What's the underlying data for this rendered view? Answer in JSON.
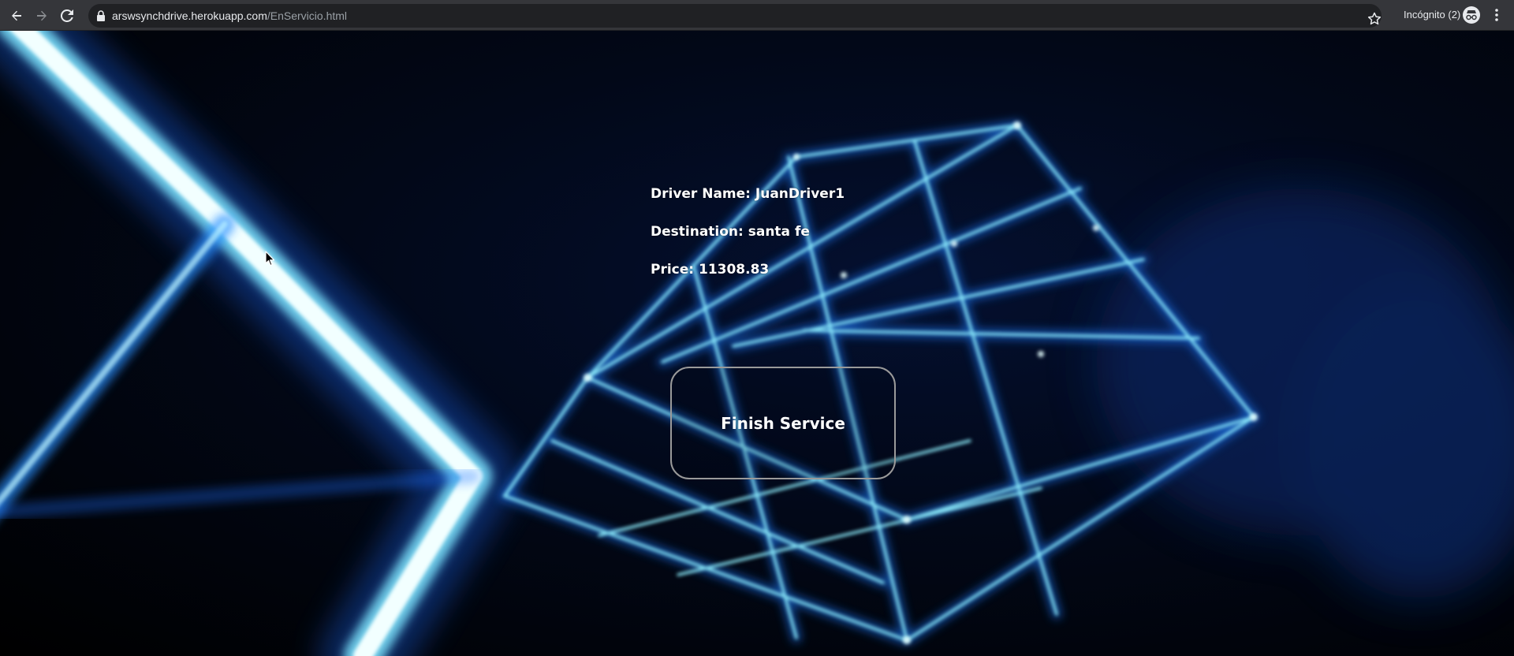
{
  "browser": {
    "url_host": "arswsynchdrive.herokuapp.com",
    "url_path": "/EnServicio.html",
    "incognito_label": "Incógnito (2)",
    "icons": {
      "back": "arrow-left-icon",
      "forward": "arrow-right-icon",
      "reload": "reload-icon",
      "lock": "lock-icon",
      "bookmark": "star-icon",
      "incognito": "incognito-icon",
      "menu": "kebab-menu-icon"
    }
  },
  "service": {
    "driver_name": "Driver Name: JuanDriver1",
    "destination": "Destination: santa fe",
    "price": "Price: 11308.83",
    "finish_label": "Finish Service"
  },
  "colors": {
    "text": "#ffffff",
    "button_border": "#9a9a9a",
    "glow": "#7fe6ff",
    "background": "#000000"
  }
}
